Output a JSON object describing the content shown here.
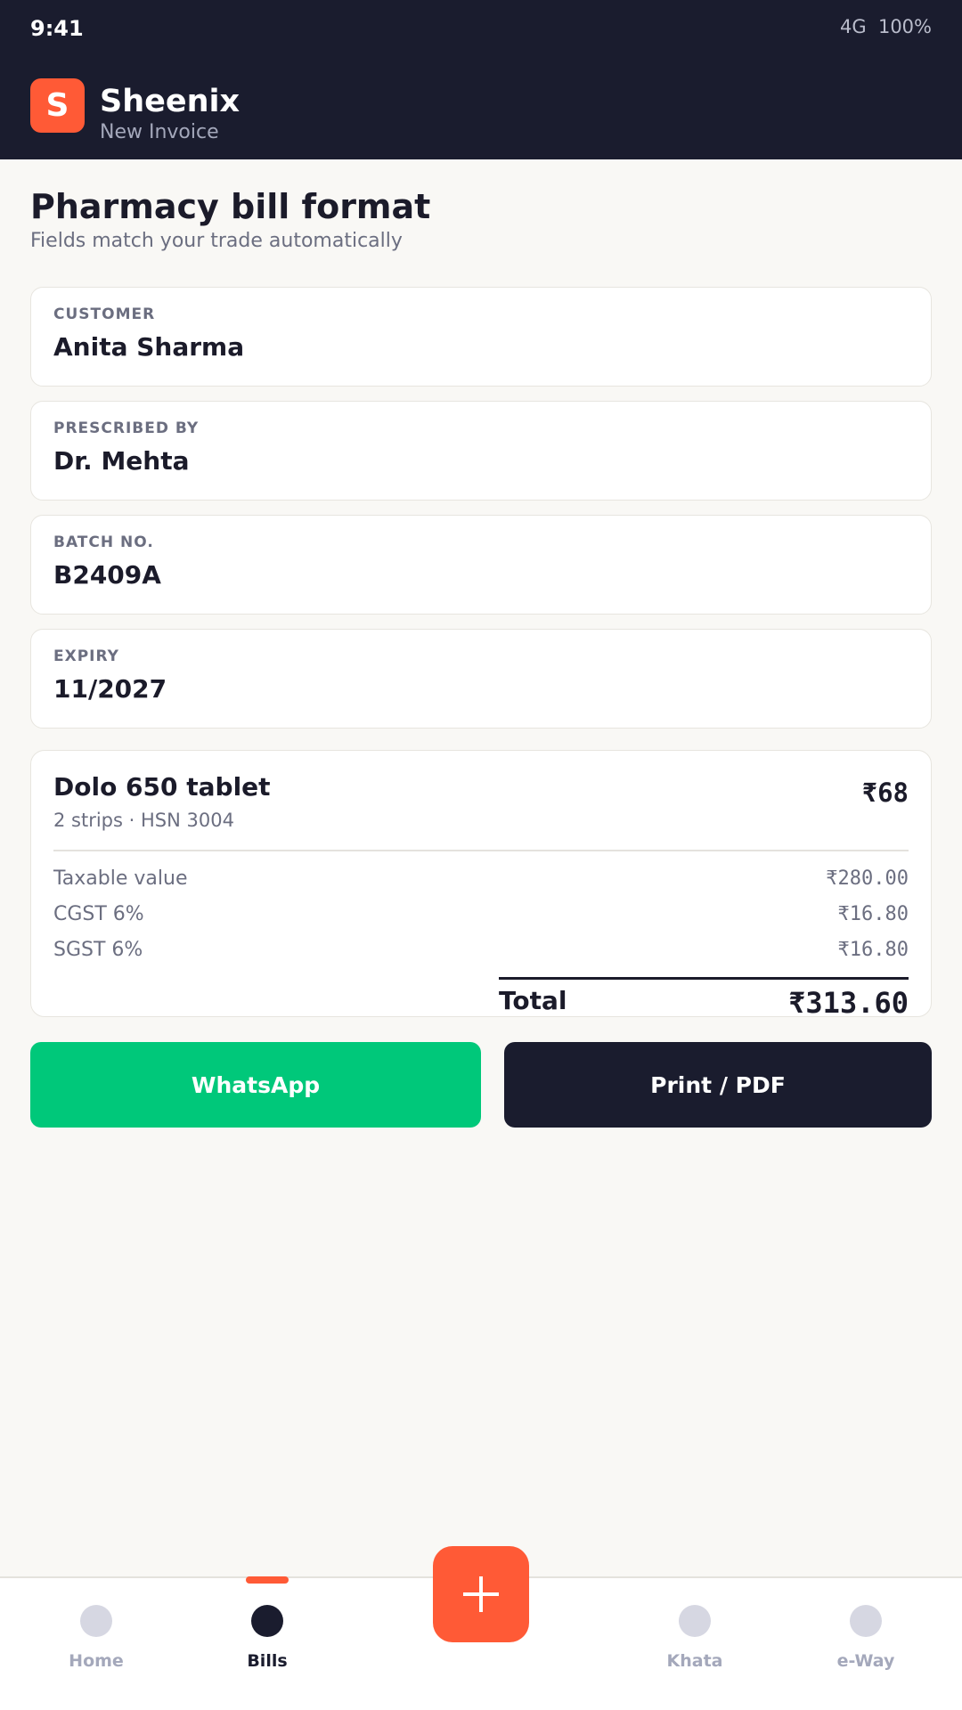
{
  "status_bar": {
    "time": "9:41",
    "network": "4G",
    "battery": "100%"
  },
  "header": {
    "logo_letter": "S",
    "app_name": "Sheenix",
    "subtitle": "New Invoice"
  },
  "page": {
    "title": "Pharmacy bill format",
    "subtitle": "Fields match your trade automatically"
  },
  "fields": [
    {
      "label": "CUSTOMER",
      "value": "Anita Sharma"
    },
    {
      "label": "PRESCRIBED BY",
      "value": "Dr. Mehta"
    },
    {
      "label": "BATCH NO.",
      "value": "B2409A"
    },
    {
      "label": "EXPIRY",
      "value": "11/2027"
    }
  ],
  "item": {
    "name": "Dolo 650 tablet",
    "meta": "2 strips · HSN 3004",
    "price": "₹68"
  },
  "taxes": [
    {
      "label": "Taxable value",
      "value": "₹280.00"
    },
    {
      "label": "CGST 6%",
      "value": "₹16.80"
    },
    {
      "label": "SGST 6%",
      "value": "₹16.80"
    }
  ],
  "total": {
    "label": "Total",
    "value": "₹313.60"
  },
  "actions": {
    "whatsapp": "WhatsApp",
    "print": "Print / PDF"
  },
  "nav": {
    "items": [
      {
        "label": "Home",
        "icon": "home-icon"
      },
      {
        "label": "Bills",
        "icon": "bills-icon",
        "active": true
      },
      {
        "label": "Khata",
        "icon": "khata-icon"
      },
      {
        "label": "e-Way",
        "icon": "eway-icon"
      }
    ],
    "fab_icon": "plus-icon"
  },
  "colors": {
    "brand": "#ff5a36",
    "header_bg": "#1a1c2e",
    "whatsapp": "#00c87a"
  }
}
